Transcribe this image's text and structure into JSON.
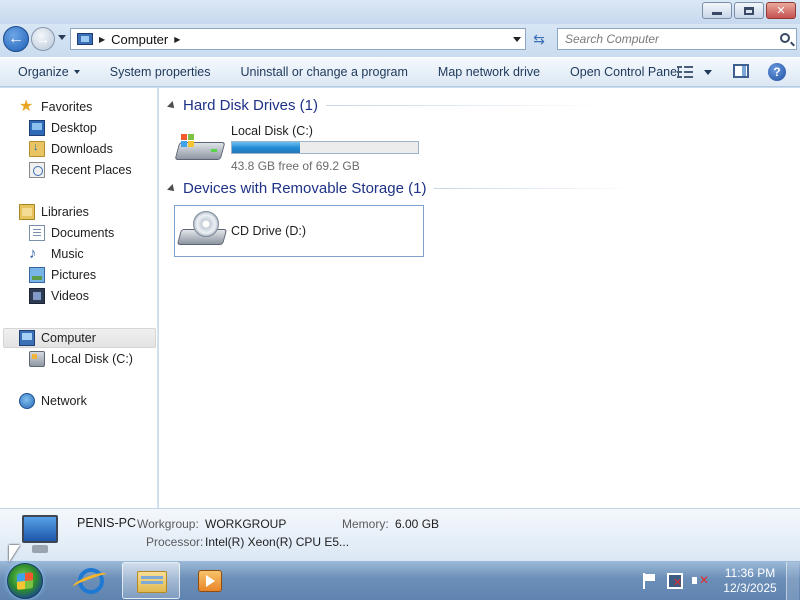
{
  "window": {
    "minimize_glyph": "",
    "close_glyph": "✕"
  },
  "address": {
    "location": "Computer",
    "separator": "▶",
    "search_placeholder": "Search Computer"
  },
  "commandbar": {
    "items": [
      {
        "label": "Organize",
        "has_menu": true
      },
      {
        "label": "System properties"
      },
      {
        "label": "Uninstall or change a program"
      },
      {
        "label": "Map network drive"
      },
      {
        "label": "Open Control Panel"
      }
    ],
    "help_glyph": "?"
  },
  "navpane": {
    "favorites": {
      "label": "Favorites",
      "items": [
        "Desktop",
        "Downloads",
        "Recent Places"
      ]
    },
    "libraries": {
      "label": "Libraries",
      "items": [
        "Documents",
        "Music",
        "Pictures",
        "Videos"
      ]
    },
    "computer": {
      "label": "Computer",
      "items": [
        "Local Disk (C:)"
      ]
    },
    "network": {
      "label": "Network"
    }
  },
  "content": {
    "hard_disk_group": {
      "title": "Hard Disk Drives (1)"
    },
    "local_disk": {
      "name": "Local Disk (C:)",
      "free_text": "43.8 GB free of 69.2 GB",
      "used_fraction": 0.367
    },
    "removable_group": {
      "title": "Devices with Removable Storage (1)"
    },
    "cd_drive": {
      "name": "CD Drive (D:)"
    }
  },
  "details": {
    "computer_name": "PENIS-PC",
    "workgroup_label": "Workgroup:",
    "workgroup_value": "WORKGROUP",
    "memory_label": "Memory:",
    "memory_value": "6.00 GB",
    "processor_label": "Processor:",
    "processor_value": "Intel(R) Xeon(R) CPU E5..."
  },
  "taskbar": {
    "time": "11:36 PM",
    "date": "12/3/2025"
  },
  "colors": {
    "accent": "#1e3287",
    "progress": "#2489d4",
    "taskbar": "#6c8fb8"
  }
}
